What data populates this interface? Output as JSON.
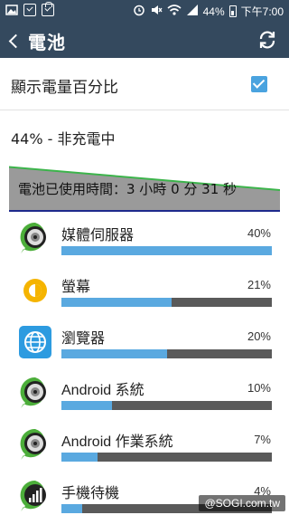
{
  "status_bar": {
    "battery_percent": "44%",
    "time": "下午7:00",
    "icons": [
      "photo-icon",
      "checkbox-icon",
      "shopping-bag-icon",
      "alarm-icon",
      "mute-icon",
      "wifi-icon",
      "signal-icon",
      "battery-icon"
    ]
  },
  "action_bar": {
    "title": "電池",
    "back_icon": "chevron-left-icon",
    "refresh_icon": "refresh-icon"
  },
  "settings": {
    "show_percentage_label": "顯示電量百分比",
    "show_percentage_checked": true,
    "battery_status": "44% - 非充電中"
  },
  "usage_graph": {
    "text": "電池已使用時間：3 小時 0 分 31 秒",
    "start_level": 0.95,
    "end_level": 0.44,
    "colors": {
      "fill": "#9a9a9a",
      "line": "#3cb44b",
      "baseline": "#1e2a8c"
    }
  },
  "apps": [
    {
      "name": "媒體伺服器",
      "percent": "40%",
      "share": 1.0,
      "icon": "media-server-icon"
    },
    {
      "name": "螢幕",
      "percent": "21%",
      "share": 0.525,
      "icon": "screen-brightness-icon"
    },
    {
      "name": "瀏覽器",
      "percent": "20%",
      "share": 0.5,
      "icon": "browser-globe-icon"
    },
    {
      "name": "Android 系統",
      "percent": "10%",
      "share": 0.24,
      "icon": "android-system-icon"
    },
    {
      "name": "Android 作業系統",
      "percent": "7%",
      "share": 0.17,
      "icon": "android-os-icon"
    },
    {
      "name": "手機待機",
      "percent": "4%",
      "share": 0.1,
      "icon": "phone-idle-icon"
    }
  ],
  "colors": {
    "bar_bg": "#34495e",
    "accent": "#4aa3df",
    "bar_fill": "#5aa9e0",
    "bar_track": "#5a5a5a"
  },
  "watermark": "@SOGI.com.tw"
}
